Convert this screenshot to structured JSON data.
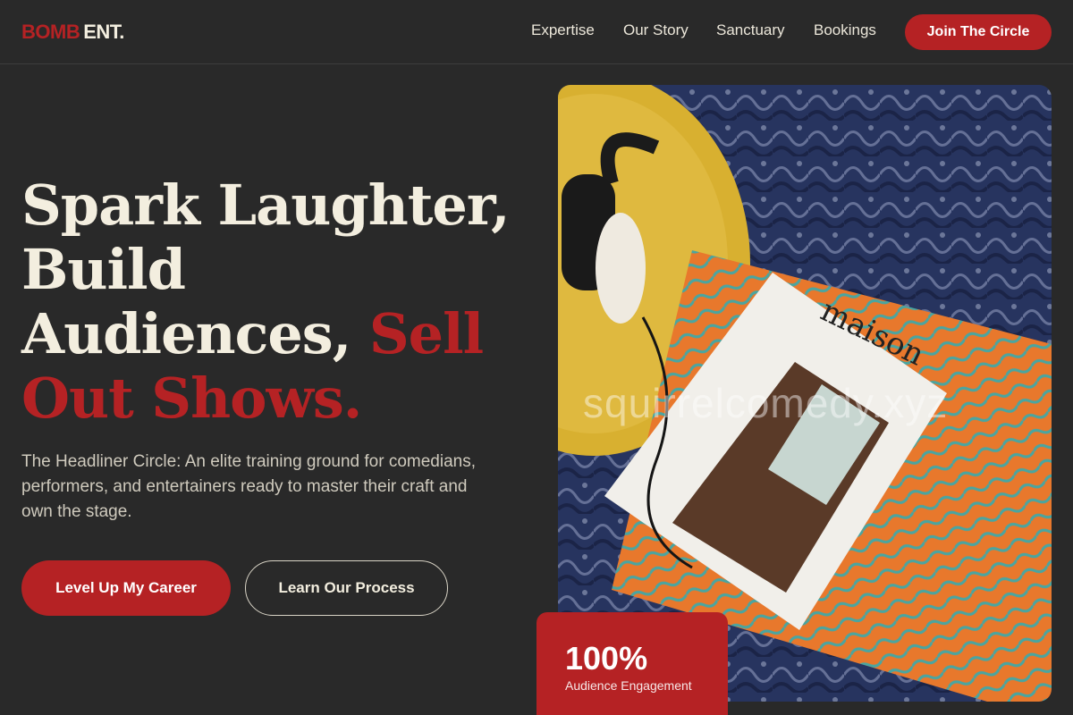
{
  "brand": {
    "part1": "BOMB",
    "part2": "ENT."
  },
  "nav": {
    "links": [
      "Expertise",
      "Our Story",
      "Sanctuary",
      "Bookings"
    ],
    "cta": "Join The Circle"
  },
  "hero": {
    "headline_line1": "Spark Laughter,",
    "headline_line2": "Build",
    "headline_line3": "Audiences,",
    "headline_accent1": "Sell",
    "headline_accent2": "Out Shows.",
    "subcopy": "The Headliner Circle: An elite training ground for comedians, performers, and entertainers ready to master their craft and own the stage.",
    "primary_cta": "Level Up My Career",
    "secondary_cta": "Learn Our Process"
  },
  "image": {
    "magazine_title": "maison",
    "watermark": "squirrelcomedy.xyz"
  },
  "stat": {
    "value": "100%",
    "label": "Audience Engagement"
  },
  "colors": {
    "accent": "#b52224",
    "background": "#292929",
    "cream": "#f3eedf"
  }
}
